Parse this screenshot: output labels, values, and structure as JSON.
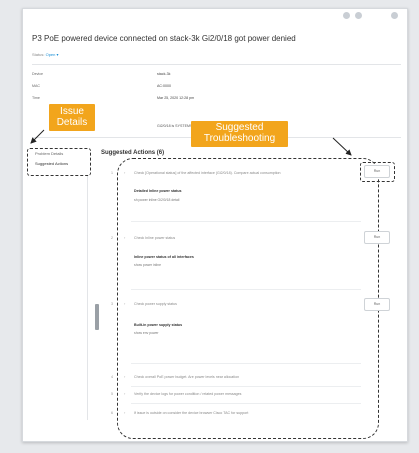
{
  "header": {
    "title": "P3 PoE powered device connected on stack-3k Gi2/0/18 got power denied",
    "status_label": "Status:",
    "status_value": "Open"
  },
  "details": [
    {
      "label": "Device",
      "value": "stack-3k"
    },
    {
      "label": "MAC",
      "value": "AC:0000"
    },
    {
      "label": "Time",
      "value": "Mar 25, 2020 12:28 pm"
    }
  ],
  "description": "Gi2/0/18 is SYSTEMS_POWER_DENY",
  "annotations": {
    "issue_details": "Issue\nDetails",
    "suggested_troubleshooting": "Suggested\nTroubleshooting"
  },
  "tabs": [
    {
      "label": "Problem Details"
    },
    {
      "label": "Suggested Actions"
    }
  ],
  "suggested_actions": {
    "title": "Suggested Actions (6)",
    "rows": [
      {
        "num": "1",
        "text": "Check [Operational status] of the affected interface (Gi2/0/18). Compare actual consumption",
        "sub": "Detailed Inline power status",
        "output": "sh power inline Gi2/0/18 detail",
        "button": "Run"
      },
      {
        "num": "2",
        "text": "Check Inline power status",
        "sub": "Inline power status of all interfaces",
        "output": "show power inline",
        "button": "Run"
      },
      {
        "num": "3",
        "text": "Check power supply status",
        "sub": "Built-in power supply status",
        "output": "show env power",
        "button": "Run"
      },
      {
        "num": "4",
        "text": "Check overall PoE power budget. Are power levels near allocation"
      },
      {
        "num": "5",
        "text": "Verify the device logs for power condition / related power messages"
      },
      {
        "num": "6",
        "text": "If issue is outside on consider the device browser Cisco TAC for support"
      }
    ]
  }
}
